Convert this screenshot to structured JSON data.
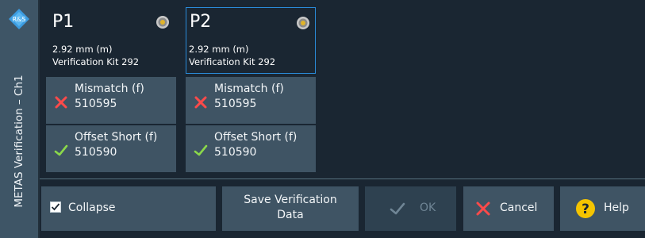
{
  "panel": {
    "title": "METAS Verification – Ch1"
  },
  "ports": [
    {
      "label": "P1",
      "connector": "2.92 mm (m)",
      "kit": "Verification Kit 292",
      "icon": "connector-icon",
      "standards": [
        {
          "name": "Mismatch (f)",
          "id": "510595",
          "status": "failed",
          "icon": "cross-icon"
        },
        {
          "name": "Offset Short (f)",
          "id": "510590",
          "status": "passed",
          "icon": "checkmark-icon"
        }
      ]
    },
    {
      "label": "P2",
      "connector": "2.92 mm (m)",
      "kit": "Verification Kit 292",
      "icon": "connector-icon",
      "standards": [
        {
          "name": "Mismatch (f)",
          "id": "510595",
          "status": "failed",
          "icon": "cross-icon"
        },
        {
          "name": "Offset Short (f)",
          "id": "510590",
          "status": "passed",
          "icon": "checkmark-icon"
        }
      ]
    }
  ],
  "buttons": {
    "collapse": {
      "label": "Collapse",
      "checked": true
    },
    "save_line1": "Save Verification",
    "save_line2": "Data",
    "ok": "OK",
    "cancel": "Cancel",
    "help": "Help"
  },
  "colors": {
    "accent_blue": "#2a8bd8",
    "fail_red": "#ff4a4a",
    "pass_green": "#8bd84a",
    "help_yellow": "#f5c400",
    "tile_bg": "#3f5464"
  }
}
